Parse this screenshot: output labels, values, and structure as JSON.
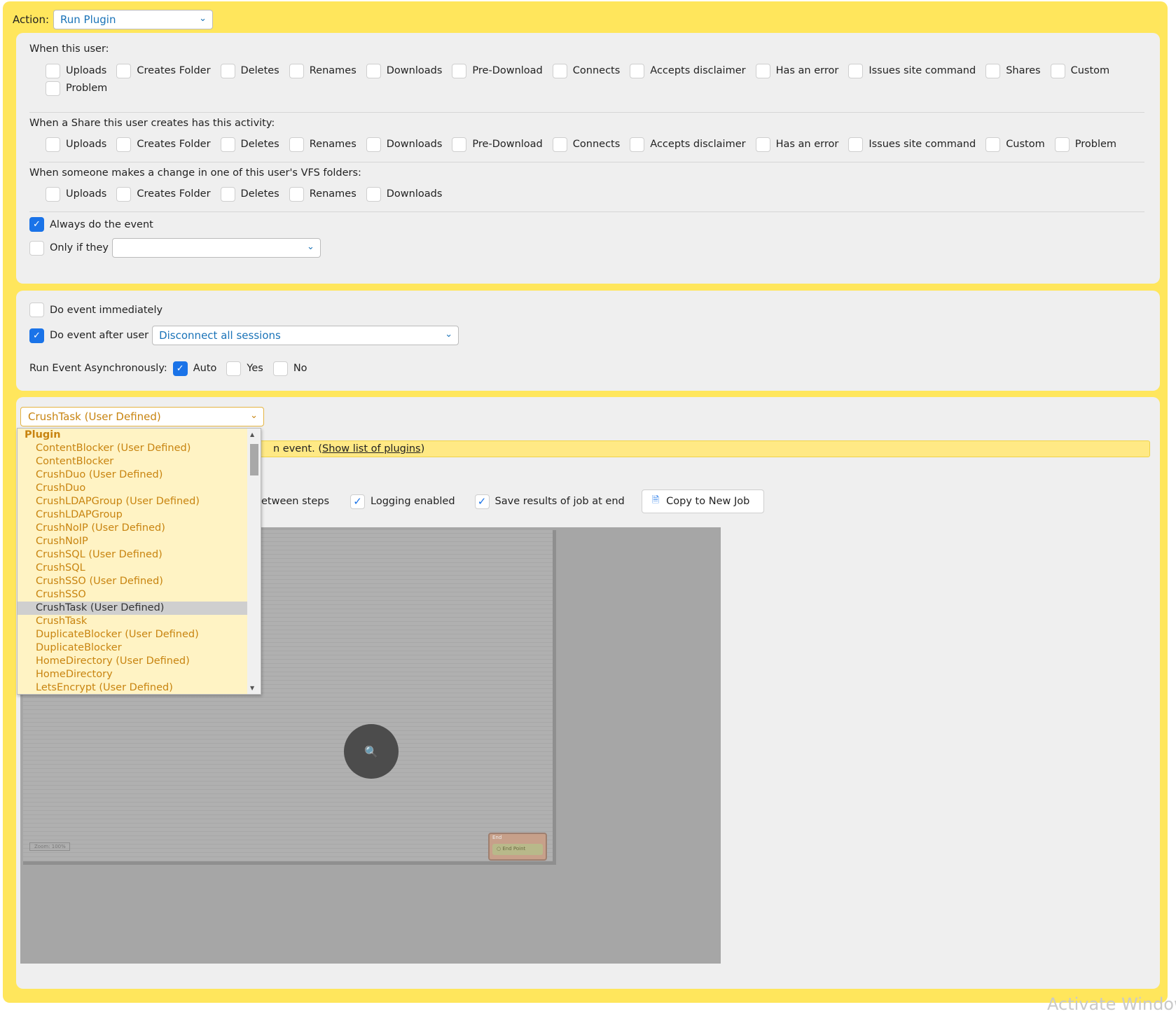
{
  "action": {
    "label": "Action:",
    "value": "Run Plugin"
  },
  "when_user": {
    "title": "When this user:",
    "row1": [
      "Uploads",
      "Creates Folder",
      "Deletes",
      "Renames",
      "Downloads",
      "Pre-Download",
      "Connects",
      "Accepts disclaimer",
      "Has an error",
      "Issues site command",
      "Shares",
      "Custom"
    ],
    "row2": [
      "Problem"
    ]
  },
  "when_share": {
    "title": "When a Share this user creates has this activity:",
    "items": [
      "Uploads",
      "Creates Folder",
      "Deletes",
      "Renames",
      "Downloads",
      "Pre-Download",
      "Connects",
      "Accepts disclaimer",
      "Has an error",
      "Issues site command",
      "Custom",
      "Problem"
    ]
  },
  "when_vfs": {
    "title": "When someone makes a change in one of this user's VFS folders:",
    "items": [
      "Uploads",
      "Creates Folder",
      "Deletes",
      "Renames",
      "Downloads"
    ]
  },
  "always": {
    "label": "Always do the event",
    "checked": true
  },
  "only_if": {
    "label": "Only if they",
    "value": ""
  },
  "timing": {
    "immediately": {
      "label": "Do event immediately",
      "checked": false
    },
    "after_user": {
      "label": "Do event after user",
      "value": "Disconnect all sessions",
      "checked": true
    }
  },
  "async": {
    "label": "Run Event Asynchronously:",
    "options": [
      "Auto",
      "Yes",
      "No"
    ],
    "selected": "Auto"
  },
  "plugin": {
    "selected": "CrushTask (User Defined)",
    "info_text": "n event. (",
    "info_link": "Show list of plugins",
    "info_end": ")"
  },
  "job_options": {
    "partial_label": "etween steps",
    "logging": "Logging enabled",
    "save_results": "Save results of job at end",
    "copy_button": "Copy to New Job"
  },
  "canvas": {
    "zoom_label": "Zoom: 100%",
    "end_node_title": "End",
    "end_point_label": "End Point"
  },
  "dropdown": {
    "group": "Plugin",
    "options": [
      "ContentBlocker (User Defined)",
      "ContentBlocker",
      "CrushDuo (User Defined)",
      "CrushDuo",
      "CrushLDAPGroup (User Defined)",
      "CrushLDAPGroup",
      "CrushNoIP (User Defined)",
      "CrushNoIP",
      "CrushSQL (User Defined)",
      "CrushSQL",
      "CrushSSO (User Defined)",
      "CrushSSO",
      "CrushTask (User Defined)",
      "CrushTask",
      "DuplicateBlocker (User Defined)",
      "DuplicateBlocker",
      "HomeDirectory (User Defined)",
      "HomeDirectory",
      "LetsEncrypt (User Defined)"
    ],
    "selected_index": 12
  },
  "watermark": "Activate Window",
  "colors": {
    "accent": "#1a73e8",
    "frame": "#ffe65c",
    "plugin": "#c88410"
  }
}
